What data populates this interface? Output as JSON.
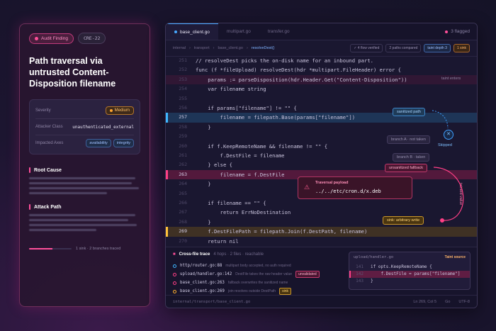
{
  "card": {
    "finding_chip": "Audit Finding",
    "id_chip": "CRE-22",
    "title": "Path traversal via untrusted Content-Disposition filename",
    "meta": [
      {
        "label": "Severity",
        "value": "Medium"
      },
      {
        "label": "Attacker Class",
        "value": "unauthenticated_external"
      },
      {
        "label": "Impacted Axes",
        "tags": [
          "availability",
          "integrity"
        ]
      }
    ],
    "section_root": "Root Cause",
    "section_attack": "Attack Path",
    "progress_text": "1 sink · 2 branches traced",
    "progress_fraction": 0.55
  },
  "editor": {
    "tabs": [
      "base_client.go",
      "multipart.go",
      "transfer.go"
    ],
    "active_tab": 0,
    "flagged": "3 flagged",
    "breadcrumb": [
      "internal",
      "transport",
      "base_client.go",
      "resolveDest()"
    ],
    "pills": [
      "4 flow verified",
      "2 paths compared",
      "taint depth 3",
      "1 sink"
    ],
    "lines": [
      {
        "n": "251",
        "code": "// resolveDest picks the on-disk name for an inbound part.",
        "style": ""
      },
      {
        "n": "252",
        "code": "func (f *fileUpload) resolveDest(hdr *multipart.FileHeader) error {",
        "style": ""
      },
      {
        "n": "253",
        "code": "    params := parseDisposition(hdr.Header.Get(\"Content-Disposition\"))",
        "style": "dim"
      },
      {
        "n": "254",
        "code": "    var filename string",
        "style": ""
      },
      {
        "n": "255",
        "code": "",
        "style": ""
      },
      {
        "n": "256",
        "code": "    if params[\"filename\"] != \"\" {",
        "style": ""
      },
      {
        "n": "257",
        "code": "        filename = filepath.Base(params[\"filename\"])",
        "style": "blue"
      },
      {
        "n": "258",
        "code": "    }",
        "style": ""
      },
      {
        "n": "259",
        "code": "",
        "style": ""
      },
      {
        "n": "260",
        "code": "    if f.KeepRemoteName && filename != \"\" {",
        "style": ""
      },
      {
        "n": "261",
        "code": "        f.DestFile = filename",
        "style": ""
      },
      {
        "n": "262",
        "code": "    } else {",
        "style": ""
      },
      {
        "n": "263",
        "code": "        filename = f.DestFile",
        "style": "red"
      },
      {
        "n": "264",
        "code": "    }",
        "style": ""
      },
      {
        "n": "265",
        "code": "",
        "style": ""
      },
      {
        "n": "266",
        "code": "    if filename == \"\" {",
        "style": ""
      },
      {
        "n": "267",
        "code": "        return ErrNoDestination",
        "style": ""
      },
      {
        "n": "268",
        "code": "    }",
        "style": ""
      },
      {
        "n": "269",
        "code": "    f.DestFilePath = filepath.Join(f.DestPath, filename)",
        "style": "yellow"
      },
      {
        "n": "270",
        "code": "    return nil",
        "style": ""
      },
      {
        "n": "271",
        "code": "}",
        "style": ""
      }
    ],
    "annotations": {
      "taint_enters": "taint enters",
      "sanitized": "sanitized path",
      "skipped": "Skipped",
      "branch_a": "branch A · not taken",
      "branch_b": "branch B · taken",
      "unsanitized": "unsanitized fallback",
      "sink": "sink: arbitrary write",
      "tainted_value": "tainted value"
    },
    "payload": {
      "title": "Traversal payload",
      "value": "../../etc/cron.d/x.deb"
    },
    "trace": {
      "title": "Cross-file trace",
      "subtitle": "4 hops · 2 files · reachable",
      "rows": [
        {
          "loc": "http/router.go:88",
          "desc": "multipart body accepted, no auth required",
          "tag": "",
          "color": "#3fb7ff"
        },
        {
          "loc": "upload/handler.go:142",
          "desc": "DestFile takes the raw header value",
          "tag": "unvalidated",
          "color": "#ff3f86"
        },
        {
          "loc": "base_client.go:263",
          "desc": "fallback overwrites the sanitized name",
          "tag": "",
          "color": "#ff3f86"
        },
        {
          "loc": "base_client.go:269",
          "desc": "join resolves outside DestPath",
          "tag": "sink",
          "color": "#ffb02e"
        }
      ]
    },
    "peek": {
      "file": "upload/handler.go",
      "source_label": "Taint source",
      "lines": [
        {
          "n": "141",
          "code": "if opts.KeepRemoteName {",
          "hl": false
        },
        {
          "n": "142",
          "code": "    f.DestFile = params[\"filename\"]",
          "hl": true
        },
        {
          "n": "143",
          "code": "}",
          "hl": false
        }
      ]
    },
    "status": {
      "path": "internal/transport/base_client.go",
      "pos": "Ln 269, Col 5",
      "lang": "Go",
      "enc": "UTF-8"
    }
  }
}
